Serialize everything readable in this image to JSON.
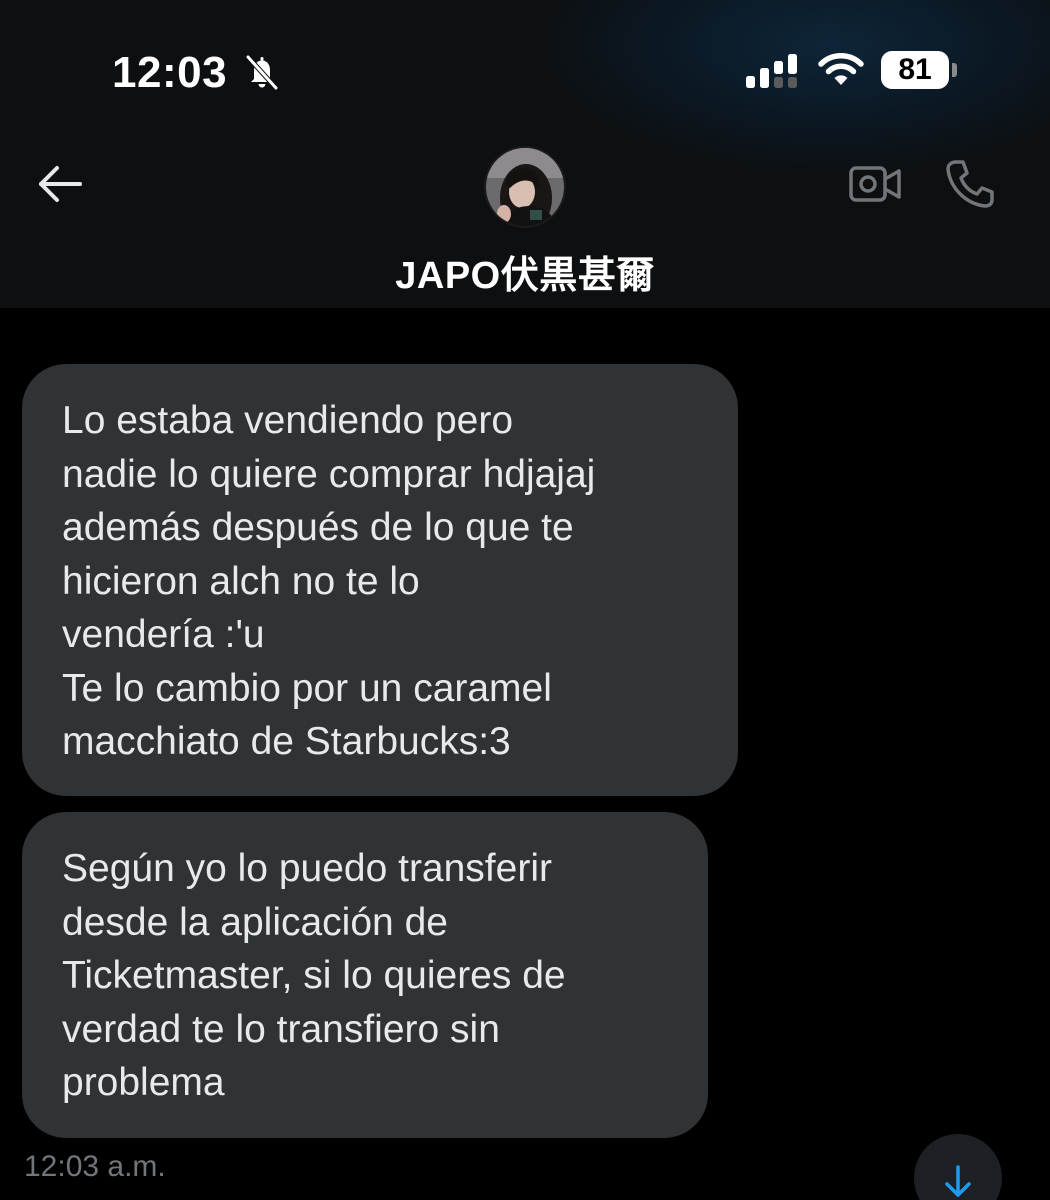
{
  "status_bar": {
    "time": "12:03",
    "battery": "81",
    "icons": [
      "bell-slash-icon",
      "cellular-signal-icon",
      "wifi-icon",
      "battery-icon"
    ]
  },
  "header": {
    "back_icon": "arrow-left-icon",
    "contact_name": "JAPO伏黒甚爾",
    "actions": [
      "video-call-icon",
      "phone-call-icon"
    ]
  },
  "messages": [
    {
      "text": "Lo estaba vendiendo pero\nnadie lo quiere comprar hdjajaj\nademás después de lo que te\nhicieron alch no te lo\nvendería :'u\nTe lo cambio por un caramel\nmacchiato de Starbucks:3"
    },
    {
      "text": "Según yo lo puedo transferir\ndesde la aplicación de\nTicketmaster, si lo quieres de\nverdad te lo transfiero sin\nproblema"
    }
  ],
  "timestamp": "12:03 a.m.",
  "scroll_button_icon": "arrow-down-icon",
  "colors": {
    "background": "#000000",
    "header_bg": "#0d0f10",
    "bubble": "#2f3336",
    "text": "#e7e9ea",
    "muted": "#71767b",
    "accent": "#1d9bf0"
  }
}
